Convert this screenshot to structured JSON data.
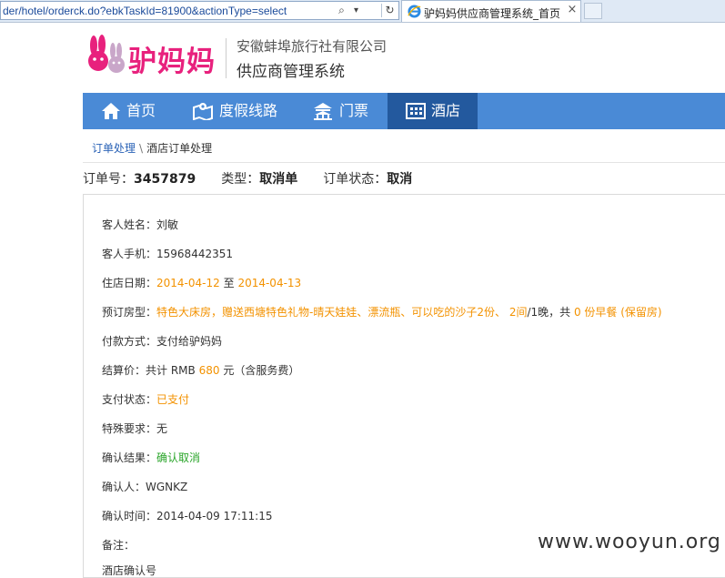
{
  "browser": {
    "url": "der/hotel/orderck.do?ebkTaskId=81900&actionType=select",
    "tab_title": "驴妈妈供应商管理系统_首页",
    "tab_close": "×",
    "search_glyph": "⌕",
    "dropdown_glyph": "▾",
    "refresh_glyph": "↻"
  },
  "header": {
    "logo_text": "驴妈妈",
    "company": "安徽蚌埠旅行社有限公司",
    "system_name": "供应商管理系统",
    "brand_color": "#e8217d"
  },
  "nav": {
    "items": [
      {
        "label": "首页",
        "icon": "home-icon"
      },
      {
        "label": "度假线路",
        "icon": "map-icon"
      },
      {
        "label": "门票",
        "icon": "temple-icon"
      },
      {
        "label": "酒店",
        "icon": "hotel-icon",
        "active": true
      }
    ],
    "bg_color": "#4a8ad6",
    "active_color": "#23599e"
  },
  "breadcrumb": {
    "parent": "订单处理",
    "separator": "\\",
    "current": "酒店订单处理"
  },
  "summary": {
    "order_no_label": "订单号：",
    "order_no": "3457879",
    "type_label": "类型：",
    "type": "取消单",
    "status_label": "订单状态：",
    "status": "取消"
  },
  "details": {
    "guest_name_label": "客人姓名：",
    "guest_name": "刘敏",
    "guest_phone_label": "客人手机：",
    "guest_phone": "15968442351",
    "stay_label": "住店日期：",
    "stay_from": "2014-04-12",
    "stay_to_word": "至",
    "stay_to": "2014-04-13",
    "room_label": "预订房型：",
    "room_name": "特色大床房，赠送西塘特色礼物-晴天娃娃、漂流瓶、可以吃的沙子2份、",
    "room_count": "2间",
    "room_slash": "/1晚，共",
    "breakfast": "0 份早餐 (保留房)",
    "payment_label": "付款方式：",
    "payment": "支付给驴妈妈",
    "settle_label": "结算价：",
    "settle_prefix": "共计 RMB",
    "settle_amount": "680",
    "settle_suffix": "元（含服务费）",
    "pay_status_label": "支付状态：",
    "pay_status": "已支付",
    "special_label": "特殊要求：",
    "special": "无",
    "confirm_result_label": "确认结果：",
    "confirm_result": "确认取消",
    "confirmer_label": "确认人：",
    "confirmer": "WGNKZ",
    "confirm_time_label": "确认时间：",
    "confirm_time": "2014-04-09 17:11:15",
    "remark_label": "备注：",
    "cut_label": "酒店确认号"
  },
  "watermark": "www.wooyun.org",
  "colors": {
    "highlight_orange": "#f39200",
    "success_green": "#2aa52a",
    "link_blue": "#2a62b6"
  }
}
